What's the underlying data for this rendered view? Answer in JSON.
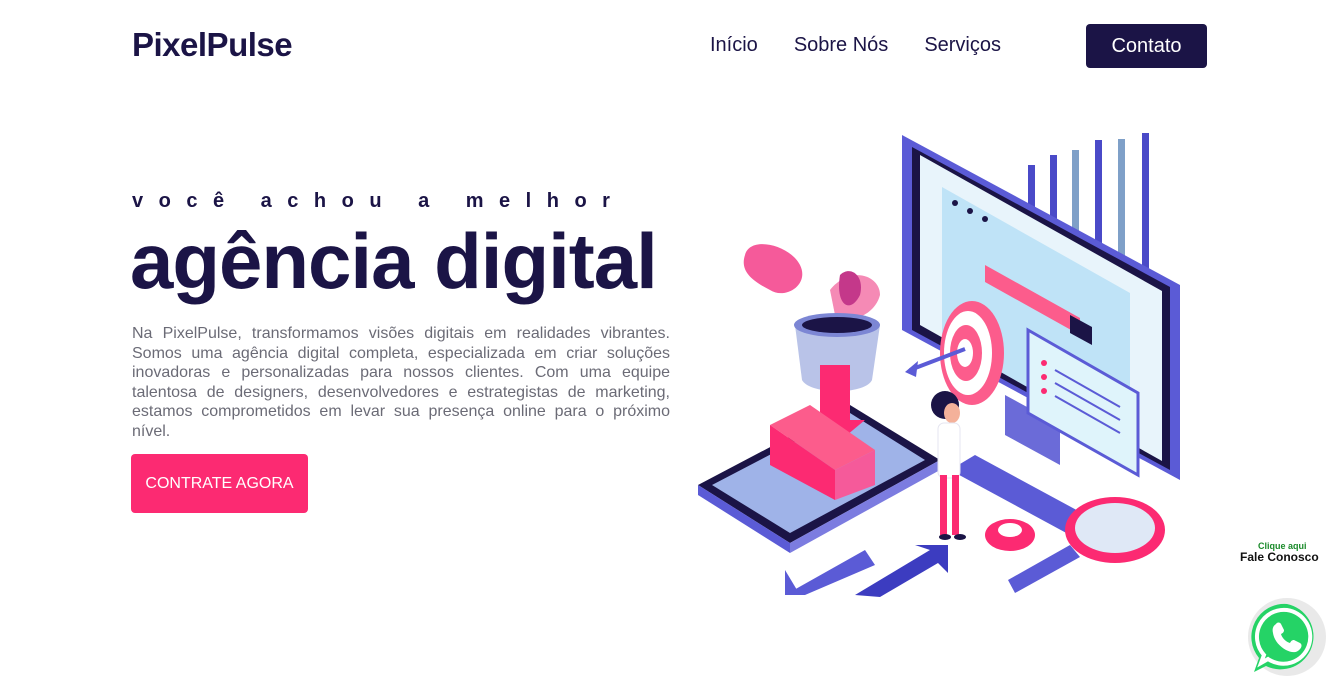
{
  "brand": {
    "logo": "PixelPulse"
  },
  "nav": {
    "items": [
      "Início",
      "Sobre Nós",
      "Serviços"
    ],
    "contact_label": "Contato"
  },
  "hero": {
    "kicker": "você achou a melhor",
    "headline": "agência digital",
    "description": "Na PixelPulse, transformamos visões digitais em realidades vibrantes. Somos uma agência digital completa, especializada em criar soluções inovadoras e personalizadas para nossos clientes. Com uma equipe talentosa de designers, desenvolvedores e estrategistas de marketing, estamos comprometidos em levar sua presença online para o próximo nível.",
    "cta_label": "CONTRATE AGORA"
  },
  "whatsapp": {
    "small_label": "Clique aqui",
    "label": "Fale Conosco",
    "icon": "whatsapp-icon"
  },
  "colors": {
    "primary": "#1b1446",
    "accent": "#fc2a72",
    "illustration_blue": "#5b5bd6",
    "whatsapp": "#25d366"
  }
}
